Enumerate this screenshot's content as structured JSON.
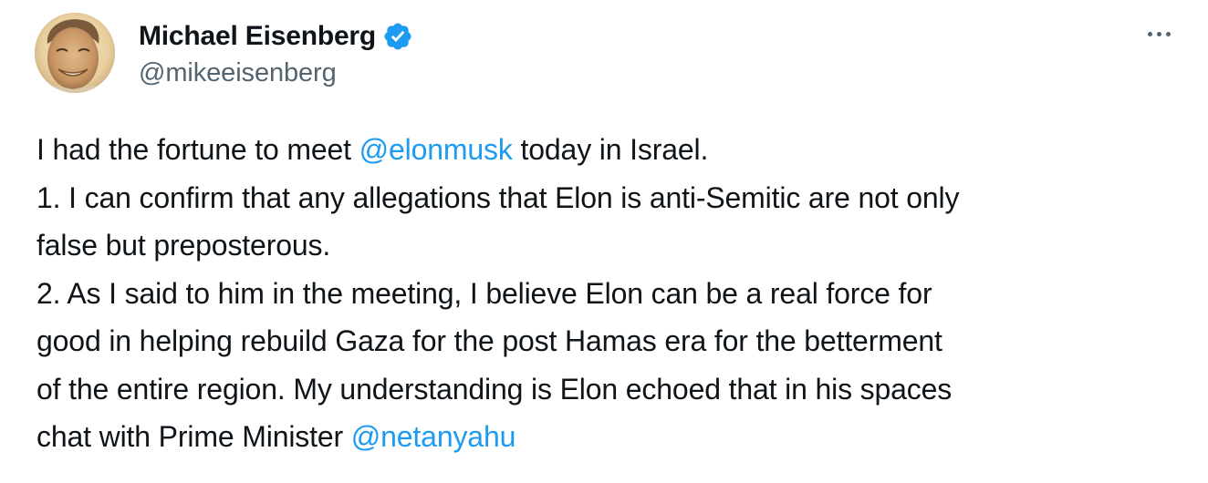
{
  "author": {
    "display_name": "Michael Eisenberg",
    "handle": "@mikeeisenberg",
    "verified": true,
    "avatar_icon": "profile-photo"
  },
  "menu": {
    "more_icon": "ellipsis-icon"
  },
  "tweet": {
    "line1_pre": "I had the fortune to meet ",
    "line1_mention": "@elonmusk",
    "line1_post": " today in Israel.",
    "line2": "1. I can confirm that any allegations that Elon is anti-Semitic are not only",
    "line3": "false but preposterous.",
    "line4": "2. As I said to him in the meeting, I believe Elon can be a real force for",
    "line5": "good in helping rebuild Gaza for the post Hamas era for the betterment",
    "line6": "of the entire region. My understanding is Elon echoed that in his spaces",
    "line7_pre": "chat with Prime Minister ",
    "line7_mention": "@netanyahu"
  },
  "colors": {
    "text": "#0f1419",
    "secondary": "#536471",
    "accent": "#1d9bf0"
  }
}
